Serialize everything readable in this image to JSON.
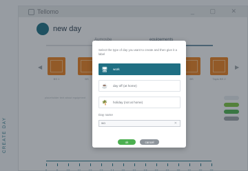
{
  "app": {
    "title": "Tellomo",
    "window_controls": "_ ▢ ✕"
  },
  "page": {
    "title": "new day"
  },
  "tabs": [
    {
      "label": "Aumosbe",
      "active": false
    },
    {
      "label": "equipements",
      "active": true
    }
  ],
  "equipments": [
    {
      "label": "BS 1"
    },
    {
      "label": "BS"
    },
    {
      "label": ""
    },
    {
      "label": ""
    },
    {
      "label": "BS"
    },
    {
      "label": "Tapis BS 2"
    }
  ],
  "nav": {
    "prev": "◀",
    "next": "▶"
  },
  "description": "placeholder text about equipment",
  "sidebar_buttons": [
    {
      "label": "",
      "color": "#dfe3e8"
    },
    {
      "label": "",
      "color": "#7ac143"
    },
    {
      "label": "",
      "color": "#4caf50"
    },
    {
      "label": "",
      "color": "#9aa0a6"
    }
  ],
  "vertical_label": "CREATE DAY",
  "timeline": {
    "ticks": [
      "8",
      "9",
      "10",
      "11",
      "12",
      "13",
      "14",
      "15",
      "16",
      "17",
      "18",
      "19",
      "20",
      "21",
      "22",
      "23"
    ]
  },
  "modal": {
    "prompt": "Select the type of day you want to create and then give it a label",
    "options": [
      {
        "label": "work",
        "icon": "monitor-icon",
        "glyph": "🖥",
        "selected": true
      },
      {
        "label": "day off (at home)",
        "icon": "coffee-icon",
        "glyph": "☕",
        "selected": false
      },
      {
        "label": "holiday (not at home)",
        "icon": "palm-tree-icon",
        "glyph": "🌴",
        "selected": false
      }
    ],
    "name_label": "Day name",
    "name_value": "wo",
    "clear_glyph": "✕",
    "ok_label": "ok",
    "cancel_label": "cancel"
  },
  "colors": {
    "accent": "#1f6f83",
    "equip": "#e67e22",
    "ok": "#4caf50",
    "cancel": "#8e959c"
  }
}
